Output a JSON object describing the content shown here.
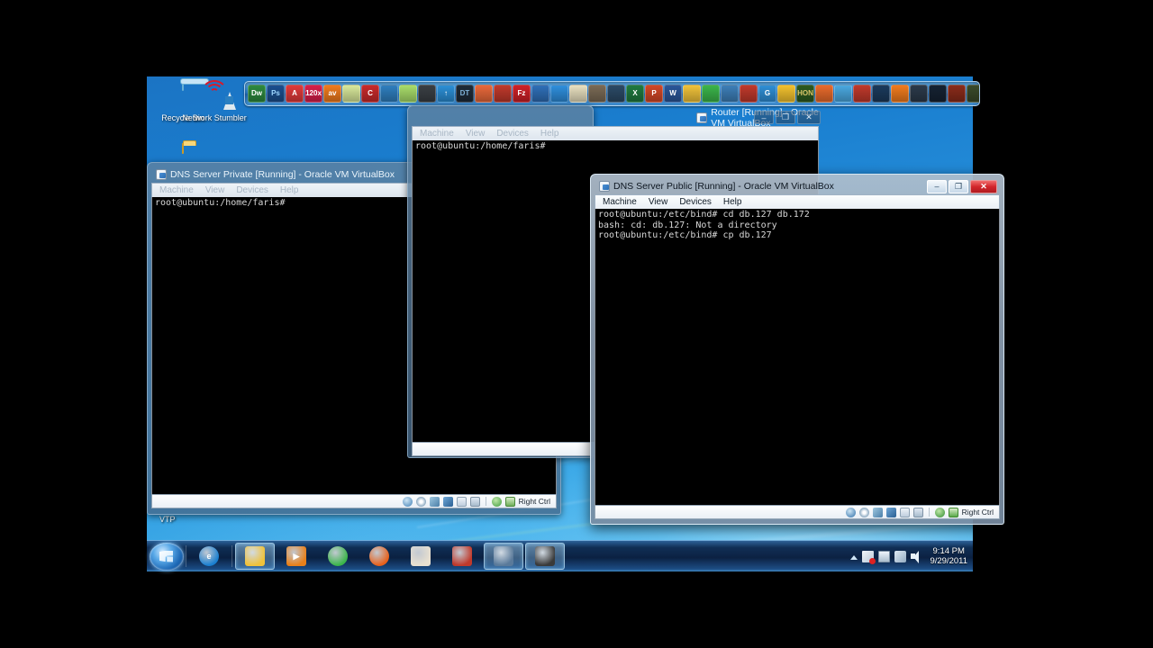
{
  "desktop": {
    "icons": [
      {
        "name": "Recycle Bin",
        "glyph": "recycle-bin"
      },
      {
        "name": "Network Stumbler",
        "glyph": "network-stumbler"
      },
      {
        "name": "",
        "glyph": "folder"
      }
    ],
    "vtp_label": "VTP"
  },
  "dock": {
    "items": [
      {
        "label": "Dw",
        "bg": "#2d8a3e",
        "fg": "#ffffff"
      },
      {
        "label": "Ps",
        "bg": "#1b4f8f",
        "fg": "#9fd6ff"
      },
      {
        "label": "A",
        "bg": "#e03a3a",
        "fg": "#ffffff"
      },
      {
        "label": "120x",
        "bg": "#d81f4a",
        "fg": "#ffffff"
      },
      {
        "label": "av",
        "bg": "#f07b1d",
        "fg": "#ffffff"
      },
      {
        "label": "",
        "bg": "#d8e89a",
        "fg": "#3a5a1a"
      },
      {
        "label": "C",
        "bg": "#c92a2a",
        "fg": "#ffffff"
      },
      {
        "label": "",
        "bg": "#2f7fbf",
        "fg": "#ffffff"
      },
      {
        "label": "",
        "bg": "#a8dd6a",
        "fg": "#24510f"
      },
      {
        "label": "",
        "bg": "#3a3f44",
        "fg": "#c6a44f"
      },
      {
        "label": "↑",
        "bg": "#2b8fd6",
        "fg": "#ffffff"
      },
      {
        "label": "DT",
        "bg": "#1e2b38",
        "fg": "#7fb2d8"
      },
      {
        "label": "",
        "bg": "#e8683a",
        "fg": "#ffffff"
      },
      {
        "label": "",
        "bg": "#c0392b",
        "fg": "#ffffff"
      },
      {
        "label": "Fz",
        "bg": "#cf2027",
        "fg": "#ffffff"
      },
      {
        "label": "",
        "bg": "#2f6fb8",
        "fg": "#ffffff"
      },
      {
        "label": "",
        "bg": "#2f8fdd",
        "fg": "#ffffff"
      },
      {
        "label": "",
        "bg": "#e8e0c0",
        "fg": "#555555"
      },
      {
        "label": "",
        "bg": "#7a6a55",
        "fg": "#ffffff"
      },
      {
        "label": "",
        "bg": "#2b4a66",
        "fg": "#cfe6f5"
      },
      {
        "label": "X",
        "bg": "#1f7a3f",
        "fg": "#ffffff"
      },
      {
        "label": "P",
        "bg": "#d24726",
        "fg": "#ffffff"
      },
      {
        "label": "W",
        "bg": "#2a5699",
        "fg": "#ffffff"
      },
      {
        "label": "",
        "bg": "#f0c23a",
        "fg": "#6a4a00"
      },
      {
        "label": "",
        "bg": "#3bb54a",
        "fg": "#ffffff"
      },
      {
        "label": "",
        "bg": "#3d7fb8",
        "fg": "#ffffff"
      },
      {
        "label": "",
        "bg": "#c0392b",
        "fg": "#ffffff"
      },
      {
        "label": "G",
        "bg": "#2f8fd6",
        "fg": "#ffffff"
      },
      {
        "label": "",
        "bg": "#f2c12e",
        "fg": "#7a5500"
      },
      {
        "label": "HON",
        "bg": "#2c5a1f",
        "fg": "#d8c46a"
      },
      {
        "label": "",
        "bg": "#e86a2b",
        "fg": "#ffffff"
      },
      {
        "label": "",
        "bg": "#4aa8e0",
        "fg": "#ffffff"
      },
      {
        "label": "",
        "bg": "#c0392b",
        "fg": "#ffffff"
      },
      {
        "label": "",
        "bg": "#1b3a5c",
        "fg": "#6fd2f5"
      },
      {
        "label": "",
        "bg": "#f07b1d",
        "fg": "#ffffff"
      },
      {
        "label": "",
        "bg": "#2b3a4a",
        "fg": "#b8c8d8"
      },
      {
        "label": "",
        "bg": "#152232",
        "fg": "#9fd6ff"
      },
      {
        "label": "",
        "bg": "#8a2b1a",
        "fg": "#f0c080"
      },
      {
        "label": "",
        "bg": "#3a4a2a",
        "fg": "#c8d8a8"
      },
      {
        "label": "",
        "bg": "#4a3a2a",
        "fg": "#d8c8a8"
      }
    ]
  },
  "taskbar": {
    "start_label": "Start",
    "buttons": [
      {
        "name": "internet-explorer",
        "label": "e",
        "bg": "#1a7fd0"
      },
      {
        "name": "windows-explorer",
        "label": "",
        "bg": "#f0c23a",
        "active": true
      },
      {
        "name": "windows-media-player",
        "label": "▶",
        "bg": "#e8801a"
      },
      {
        "name": "green-app",
        "label": "",
        "bg": "#3bb54a"
      },
      {
        "name": "firefox",
        "label": "",
        "bg": "#e8601a"
      },
      {
        "name": "paint",
        "label": "",
        "bg": "#e8e0d0"
      },
      {
        "name": "book-app",
        "label": "",
        "bg": "#c0392b"
      },
      {
        "name": "virtualbox",
        "label": "",
        "bg": "#5a7a9a",
        "active": true
      },
      {
        "name": "camtasia-recorder",
        "label": "",
        "bg": "#3a3a3a",
        "active": true
      }
    ],
    "tray": {
      "icons": [
        "show-hidden-icons",
        "action-center-flag",
        "display-icon",
        "network-icon",
        "volume-icon"
      ],
      "time": "9:14 PM",
      "date": "9/29/2011"
    }
  },
  "windows": [
    {
      "id": "dns-server-private",
      "title": "DNS Server Private [Running] - Oracle VM VirtualBox",
      "active": false,
      "menu": [
        "Machine",
        "View",
        "Devices",
        "Help"
      ],
      "buttons": {
        "minimize": "–",
        "maximize": "❐",
        "close": "✕"
      },
      "terminal_lines": [
        "root@ubuntu:/home/faris#"
      ],
      "status": {
        "shortcut": "Right Ctrl"
      }
    },
    {
      "id": "router",
      "title": "Router [Running] - Oracle VM VirtualBox",
      "active": false,
      "menu": [
        "Machine",
        "View",
        "Devices",
        "Help"
      ],
      "buttons": {
        "minimize": "–",
        "maximize": "❐",
        "close": "✕"
      },
      "terminal_lines": [
        "root@ubuntu:/home/faris#"
      ],
      "status": {
        "shortcut": ""
      }
    },
    {
      "id": "dns-server-public",
      "title": "DNS Server Public [Running] - Oracle VM VirtualBox",
      "active": true,
      "menu": [
        "Machine",
        "View",
        "Devices",
        "Help"
      ],
      "buttons": {
        "minimize": "–",
        "maximize": "❐",
        "close": "✕"
      },
      "terminal_lines": [
        "root@ubuntu:/etc/bind# cd db.127 db.172",
        "bash: cd: db.127: Not a directory",
        "root@ubuntu:/etc/bind# cp db.127"
      ],
      "status": {
        "shortcut": "Right Ctrl"
      }
    }
  ],
  "colors": {
    "desktop_blue": "#2a94dd",
    "active_title": "#c8d8e6",
    "inactive_title": "#2f91dd",
    "close_red": "#d2262b",
    "terminal_bg": "#000000",
    "terminal_fg": "#d8d8d8"
  }
}
